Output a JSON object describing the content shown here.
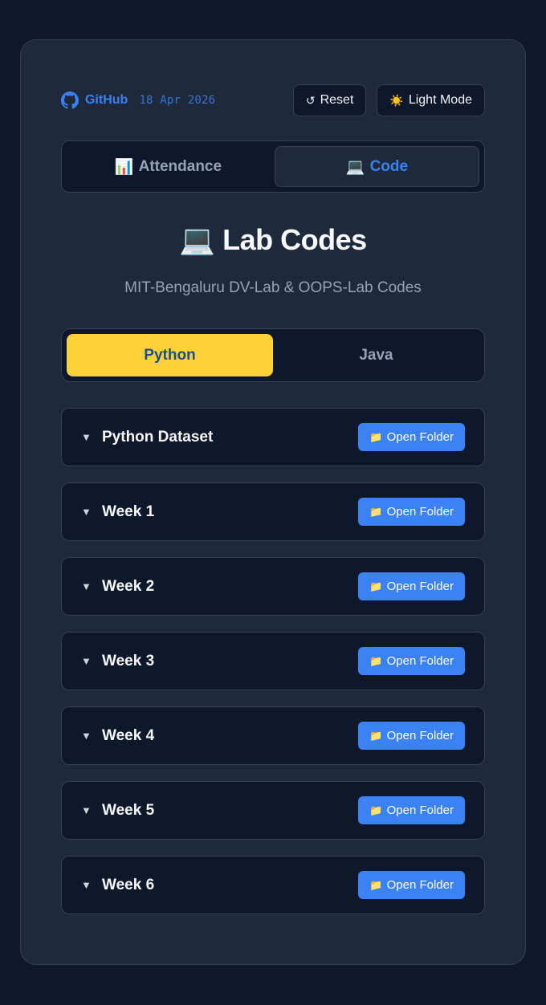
{
  "header": {
    "github_label": "GitHub",
    "date": "18 Apr 2026",
    "reset_label": "Reset",
    "reset_icon": "↺",
    "theme_label": "Light Mode",
    "theme_icon": "☀️"
  },
  "main_tabs": [
    {
      "icon": "📊",
      "label": "Attendance",
      "active": false
    },
    {
      "icon": "💻",
      "label": "Code",
      "active": true
    }
  ],
  "page": {
    "title_icon": "💻",
    "title": "Lab Codes",
    "subtitle": "MIT-Bengaluru DV-Lab & OOPS-Lab Codes"
  },
  "lang_tabs": [
    {
      "label": "Python",
      "active": true
    },
    {
      "label": "Java",
      "active": false
    }
  ],
  "folders": {
    "button_icon": "📁",
    "button_label": "Open Folder",
    "caret": "▼",
    "items": [
      {
        "name": "Python Dataset"
      },
      {
        "name": "Week 1"
      },
      {
        "name": "Week 2"
      },
      {
        "name": "Week 3"
      },
      {
        "name": "Week 4"
      },
      {
        "name": "Week 5"
      },
      {
        "name": "Week 6"
      }
    ]
  },
  "colors": {
    "background": "#0f172a",
    "card": "#1e293b",
    "accent": "#3b82f6",
    "active_lang": "#fdd138"
  }
}
